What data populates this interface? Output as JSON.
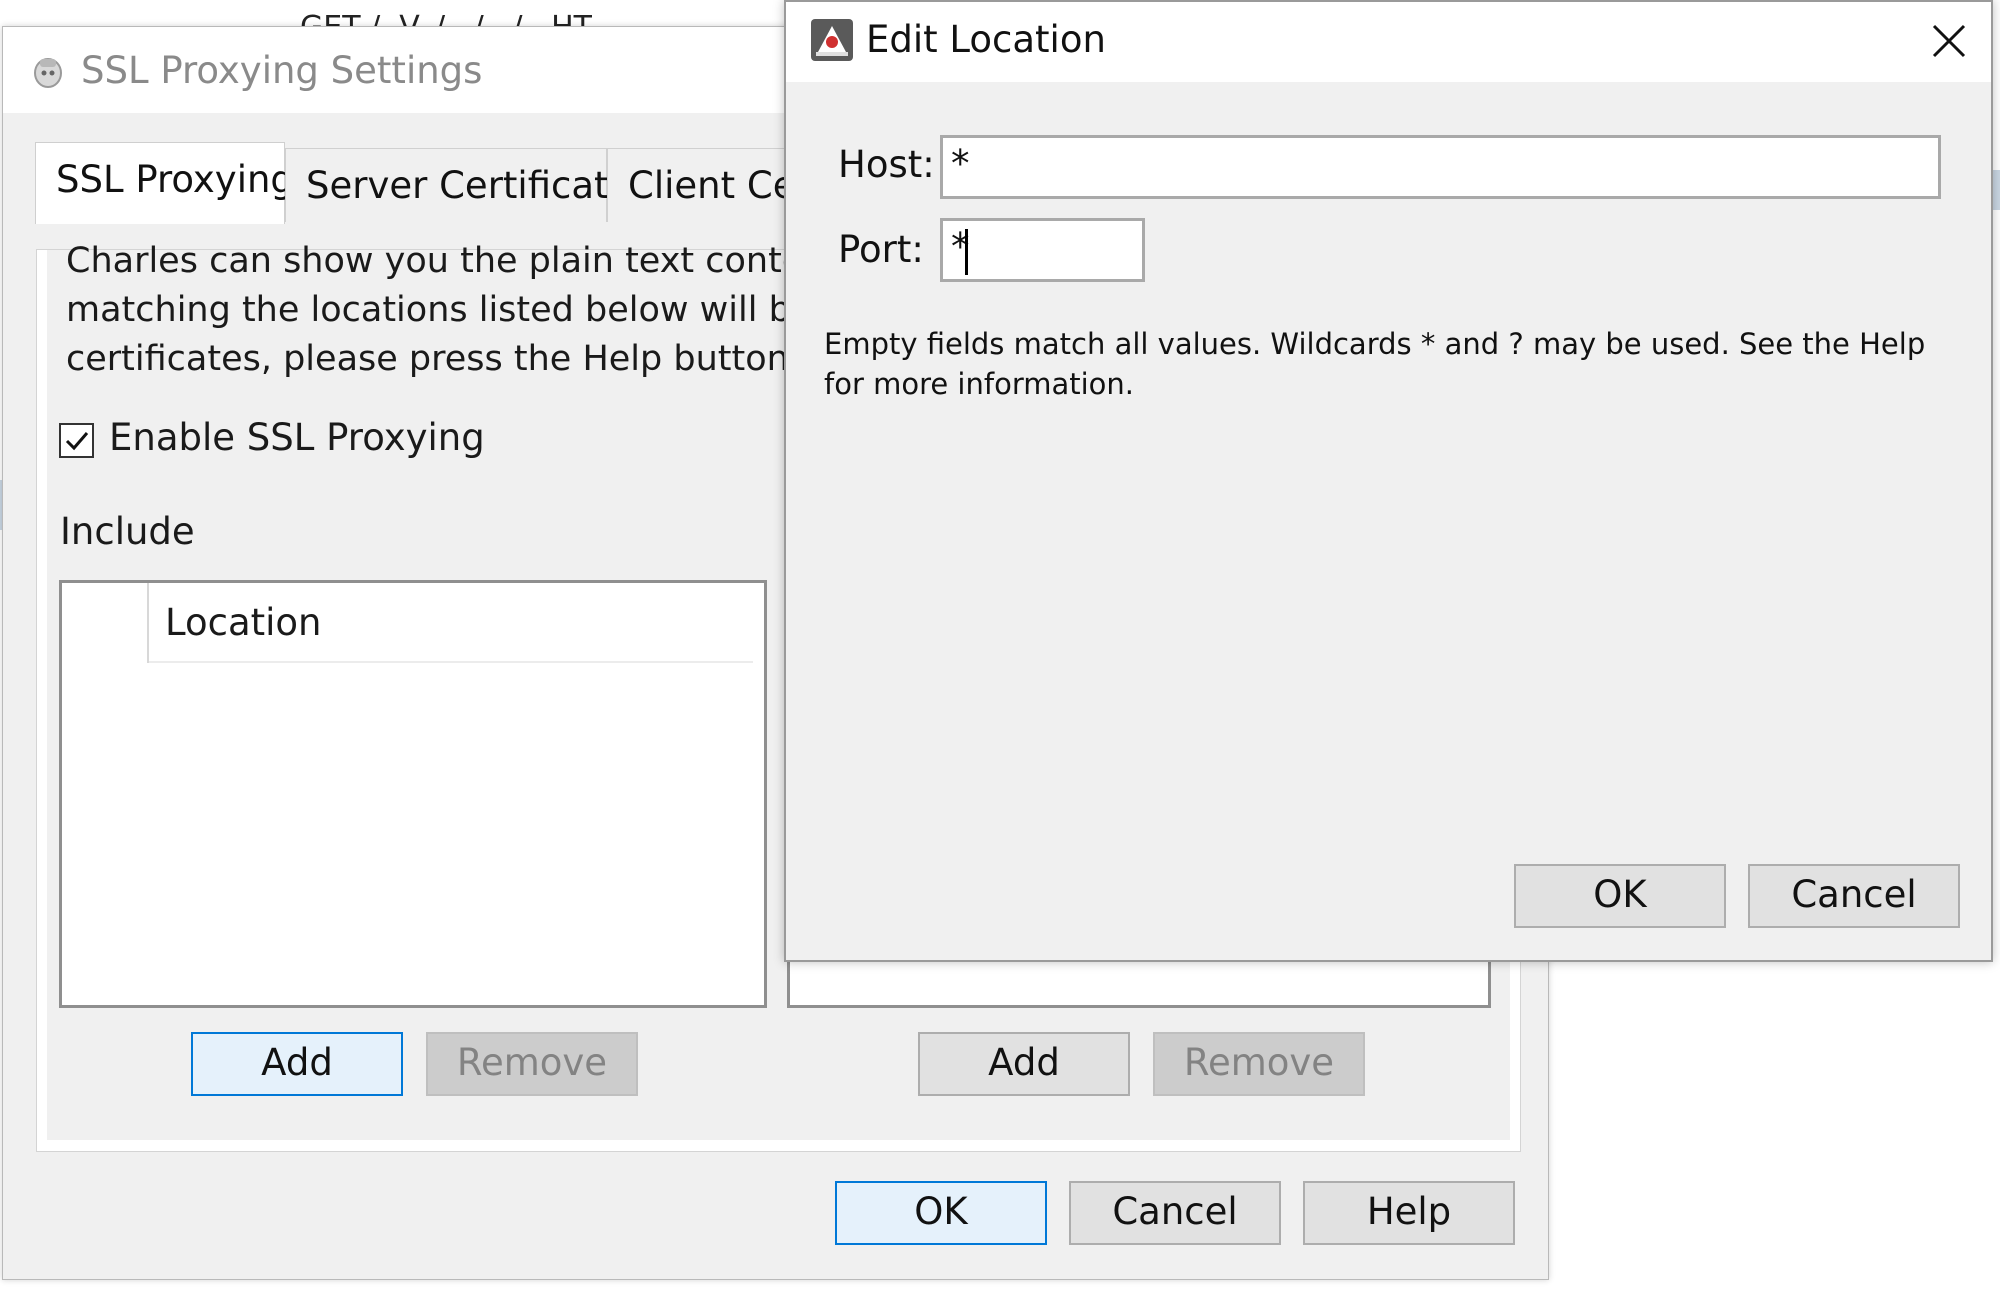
{
  "background": {
    "partial_text": "GET /..V../.../.../...HT"
  },
  "main_dialog": {
    "title": "SSL Proxying Settings",
    "tabs": [
      {
        "label": "SSL Proxying",
        "active": true
      },
      {
        "label": "Server Certificates",
        "active": false
      },
      {
        "label": "Client Cer",
        "active": false
      }
    ],
    "description_lines": [
      "Charles can show you the plain text contents",
      "matching the locations listed below will be p",
      "certificates, please press the Help button for"
    ],
    "enable_ssl": {
      "label": "Enable SSL Proxying",
      "checked": true
    },
    "include": {
      "label": "Include",
      "column_header": "Location",
      "rows": [],
      "add_label": "Add",
      "remove_label": "Remove"
    },
    "exclude": {
      "add_label": "Add",
      "remove_label": "Remove"
    },
    "footer": {
      "ok_label": "OK",
      "cancel_label": "Cancel",
      "help_label": "Help"
    }
  },
  "edit_location": {
    "title": "Edit Location",
    "host": {
      "label": "Host:",
      "value": "*"
    },
    "port": {
      "label": "Port:",
      "value": "*"
    },
    "hint": "Empty fields match all values. Wildcards * and ? may be used. See the Help for more information.",
    "ok_label": "OK",
    "cancel_label": "Cancel"
  },
  "colors": {
    "dialog_bg": "#f0f0f0",
    "default_button_border": "#0078d7",
    "default_button_bg": "#e5f1fb",
    "disabled_text": "#838383"
  }
}
